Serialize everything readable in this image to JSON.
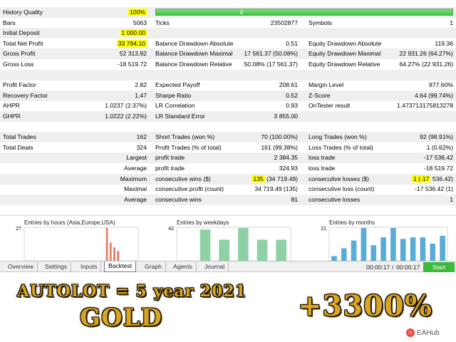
{
  "report": {
    "rows": [
      {
        "shade": true,
        "cells": [
          {
            "label": "History Quality",
            "value": "100%",
            "value_highlight": true
          },
          {
            "label": "",
            "value": ""
          },
          {
            "label": "",
            "value": ""
          }
        ],
        "quality_bar": true
      },
      {
        "shade": false,
        "cells": [
          {
            "label": "Bars",
            "value": "5063"
          },
          {
            "label": "Ticks",
            "value": "23502877"
          },
          {
            "label": "Symbols",
            "value": "1"
          }
        ]
      },
      {
        "shade": true,
        "cells": [
          {
            "label": "Initial Deposit",
            "value": "1 000.00",
            "value_highlight": true
          },
          {
            "label": "",
            "value": ""
          },
          {
            "label": "",
            "value": ""
          }
        ]
      },
      {
        "shade": false,
        "cells": [
          {
            "label": "Total Net Profit",
            "value": "33 794.10",
            "value_highlight": true
          },
          {
            "label": "Balance Drawdown Absolute",
            "value": "0.51"
          },
          {
            "label": "Equity Drawdown Absolute",
            "value": "119.36"
          }
        ]
      },
      {
        "shade": true,
        "cells": [
          {
            "label": "Gross Profit",
            "value": "52 313.82"
          },
          {
            "label": "Balance Drawdown Maximal",
            "value": "17 561.37 (50.08%)"
          },
          {
            "label": "Equity Drawdown Maximal",
            "value": "22 931.26 (64.27%)"
          }
        ]
      },
      {
        "shade": false,
        "cells": [
          {
            "label": "Gross Loss",
            "value": "-18 519.72"
          },
          {
            "label": "Balance Drawdown Relative",
            "value": "50.08% (17 561.37)"
          },
          {
            "label": "Equity Drawdown Relative",
            "value": "64.27% (22 931.26)"
          }
        ]
      },
      {
        "shade": true,
        "cells": [
          {
            "label": "",
            "value": ""
          },
          {
            "label": "",
            "value": ""
          },
          {
            "label": "",
            "value": ""
          }
        ]
      },
      {
        "shade": false,
        "cells": [
          {
            "label": "Profit Factor",
            "value": "2.82"
          },
          {
            "label": "Expected Payoff",
            "value": "208.61"
          },
          {
            "label": "Margin Level",
            "value": "877.60%"
          }
        ]
      },
      {
        "shade": true,
        "cells": [
          {
            "label": "Recovery Factor",
            "value": "1.47"
          },
          {
            "label": "Sharpe Ratio",
            "value": "0.52"
          },
          {
            "label": "Z-Score",
            "value": "4.64 (99.74%)"
          }
        ]
      },
      {
        "shade": false,
        "cells": [
          {
            "label": "AHPR",
            "value": "1.0237 (2.37%)"
          },
          {
            "label": "LR Correlation",
            "value": "0.93"
          },
          {
            "label": "OnTester result",
            "value": "1.473713175813278"
          }
        ]
      },
      {
        "shade": true,
        "cells": [
          {
            "label": "GHPR",
            "value": "1.0222 (2.22%)"
          },
          {
            "label": "LR Standard Error",
            "value": "3 855.00"
          },
          {
            "label": "",
            "value": ""
          }
        ]
      },
      {
        "shade": false,
        "cells": [
          {
            "label": "",
            "value": ""
          },
          {
            "label": "",
            "value": ""
          },
          {
            "label": "",
            "value": ""
          }
        ]
      },
      {
        "shade": true,
        "cells": [
          {
            "label": "Total Trades",
            "value": "162"
          },
          {
            "label": "Short Trades (won %)",
            "value": "70 (100.00%)"
          },
          {
            "label": "Long Trades (won %)",
            "value": "92 (98.91%)"
          }
        ]
      },
      {
        "shade": false,
        "cells": [
          {
            "label": "Total Deals",
            "value": "324"
          },
          {
            "label": "Profit Trades (% of total)",
            "value": "161 (99.38%)"
          },
          {
            "label": "Loss Trades (% of total)",
            "value": "1 (0.62%)"
          }
        ]
      },
      {
        "shade": true,
        "right_label": "Largest",
        "cells": [
          {
            "label": "",
            "value": ""
          },
          {
            "label": "profit trade",
            "value": "2 384.35"
          },
          {
            "label": "loss trade",
            "value": "-17 536.42"
          }
        ]
      },
      {
        "shade": false,
        "right_label": "Average",
        "cells": [
          {
            "label": "",
            "value": ""
          },
          {
            "label": "profit trade",
            "value": "324.93"
          },
          {
            "label": "loss trade",
            "value": "-18 519.72"
          }
        ]
      },
      {
        "shade": true,
        "right_label": "Maximum",
        "cells": [
          {
            "label": "",
            "value": ""
          },
          {
            "label": "consecutive wins ($)",
            "value": "135 (34 719.49)",
            "value_highlight_prefix": "135"
          },
          {
            "label": "consecutive losses ($)",
            "value": "1 (-17 536.42)",
            "value_highlight_prefix": "1 (-17"
          }
        ]
      },
      {
        "shade": false,
        "right_label": "Maximal",
        "cells": [
          {
            "label": "",
            "value": ""
          },
          {
            "label": "consecutive profit (count)",
            "value": "34 719.49 (135)"
          },
          {
            "label": "consecutive loss (count)",
            "value": "-17 536.42 (1)"
          }
        ]
      },
      {
        "shade": true,
        "right_label": "Average",
        "cells": [
          {
            "label": "",
            "value": ""
          },
          {
            "label": "consecutive wins",
            "value": "81"
          },
          {
            "label": "consecutive losses",
            "value": "1"
          }
        ]
      }
    ]
  },
  "chart_data": [
    {
      "type": "bar",
      "title": "Entries by hours (Asia,Europe,USA)",
      "ymax_label": "27",
      "color": "#e2826b",
      "values": [
        0,
        0,
        0,
        0,
        0,
        0,
        0,
        0,
        0,
        0,
        0,
        0,
        0,
        0,
        0,
        0,
        0,
        0,
        0,
        0,
        0,
        0,
        27,
        15,
        11,
        8,
        0,
        0,
        0,
        0,
        0
      ]
    },
    {
      "type": "bar",
      "title": "Entries by weekdays",
      "ymax_label": "42",
      "color": "#8fd1a6",
      "values": [
        0,
        40,
        27,
        42,
        27,
        27
      ]
    },
    {
      "type": "bar",
      "title": "Entries by months",
      "ymax_label": "21",
      "color": "#5aacd8",
      "values": [
        3,
        8,
        13,
        21,
        10,
        15,
        21,
        14,
        15,
        15,
        11,
        16
      ]
    }
  ],
  "tabs": [
    {
      "label": "Overview",
      "active": false
    },
    {
      "label": "Settings",
      "active": false
    },
    {
      "label": "Inputs",
      "active": false
    },
    {
      "label": "Backtest",
      "active": true
    },
    {
      "label": "Graph",
      "active": false
    },
    {
      "label": "Agents",
      "active": false
    },
    {
      "label": "Journal",
      "active": false
    }
  ],
  "timers": {
    "elapsed": "00:00:17",
    "sep": "/",
    "total": "00:00:17"
  },
  "start_label": "Start",
  "banner": {
    "headline": "AUTOLOT = 5  year 2021",
    "gold": "GOLD",
    "percent": "+3300%",
    "watermark": "EAHub"
  }
}
